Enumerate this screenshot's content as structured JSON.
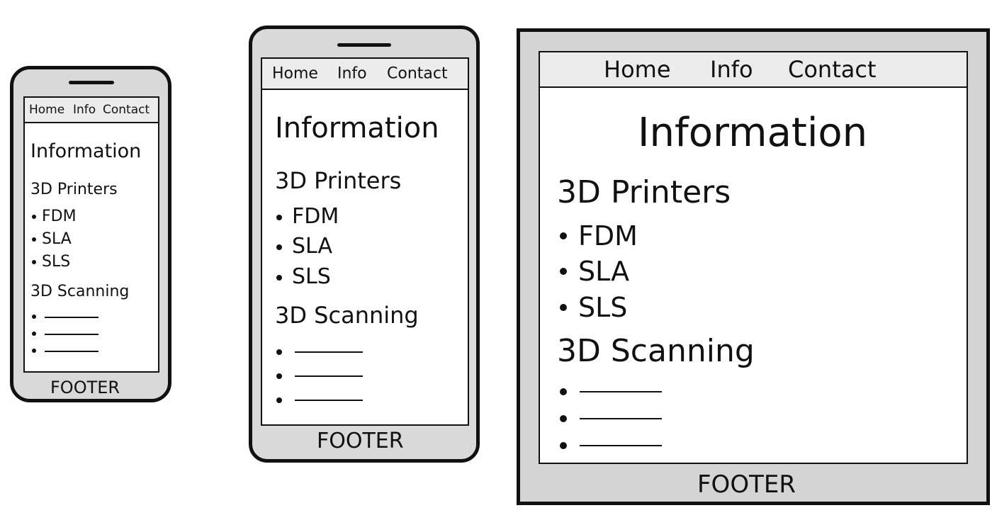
{
  "nav": [
    "Home",
    "Info",
    "Contact"
  ],
  "content": {
    "title": "Information",
    "section1_heading": "3D Printers",
    "printer_types": [
      "FDM",
      "SLA",
      "SLS"
    ],
    "section2_heading": "3D Scanning"
  },
  "footer": "FOOTER"
}
